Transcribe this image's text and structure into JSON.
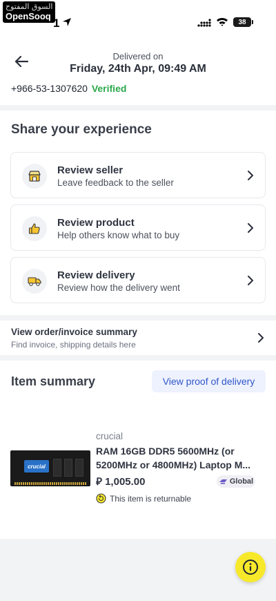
{
  "status_bar": {
    "watermark_arabic": "السوق المفتوح",
    "watermark_brand": "OpenSooq",
    "time_tail": "1",
    "battery": "38"
  },
  "header": {
    "subtitle": "Delivered on",
    "title": "Friday, 24th Apr, 09:49 AM"
  },
  "contact": {
    "phone": "+966-53-1307620",
    "verified_label": "Verified",
    "verified_color": "#2aa84a"
  },
  "experience": {
    "title": "Share your experience",
    "cards": [
      {
        "icon": "store-icon",
        "title": "Review seller",
        "subtitle": "Leave feedback to the seller"
      },
      {
        "icon": "thumbs-up-icon",
        "title": "Review product",
        "subtitle": "Help others know what to buy"
      },
      {
        "icon": "delivery-truck-icon",
        "title": "Review delivery",
        "subtitle": "Review how the delivery went"
      }
    ]
  },
  "order_summary": {
    "title": "View order/invoice summary",
    "subtitle": "Find invoice, shipping details here"
  },
  "item_summary": {
    "title": "Item summary",
    "proof_button": "View proof of delivery",
    "item": {
      "brand": "crucial",
      "thumbnail_label": "crucial",
      "name": "RAM 16GB DDR5 5600MHz (or 5200MHz or 4800MHz) Laptop M...",
      "currency_symbol": "⃁",
      "price": "1,005.00",
      "badge": "Global",
      "returnable_text": "This item is returnable"
    }
  },
  "colors": {
    "accent_blue": "#2f55c8",
    "help_yellow": "#f7e92a"
  }
}
